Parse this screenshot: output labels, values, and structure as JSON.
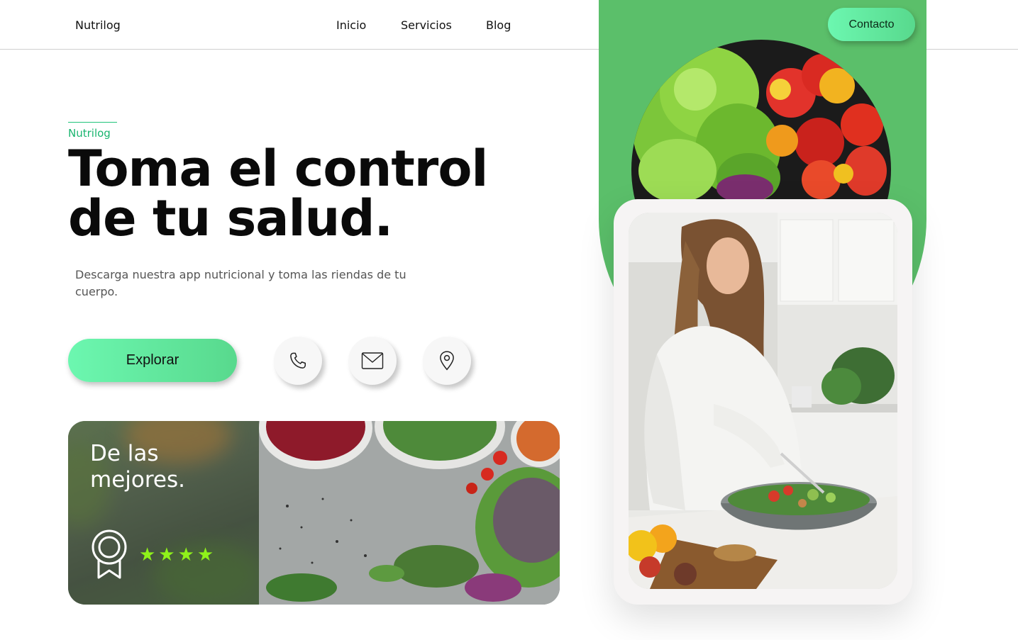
{
  "header": {
    "brand": "Nutrilog",
    "nav": [
      {
        "label": "Inicio"
      },
      {
        "label": "Servicios"
      },
      {
        "label": "Blog"
      }
    ],
    "contact_label": "Contacto"
  },
  "hero": {
    "eyebrow": "Nutrilog",
    "headline_line1": "Toma el control",
    "headline_line2": "de tu salud.",
    "subtitle": "Descarga nuestra app nutricional y toma las riendas de tu cuerpo.",
    "explore_label": "Explorar"
  },
  "icons": [
    "phone-icon",
    "mail-icon",
    "location-pin-icon",
    "award-ribbon-icon",
    "star-icon"
  ],
  "card": {
    "title_line1": "De las",
    "title_line2": "mejores.",
    "rating": 4,
    "stars_text": "★★★★"
  },
  "colors": {
    "accent_green": "#5bbf6a",
    "button_gradient_start": "#6cf7b0",
    "button_gradient_end": "#58d98d",
    "eyebrow_green": "#19b56f",
    "star_color": "#8ff21a"
  }
}
